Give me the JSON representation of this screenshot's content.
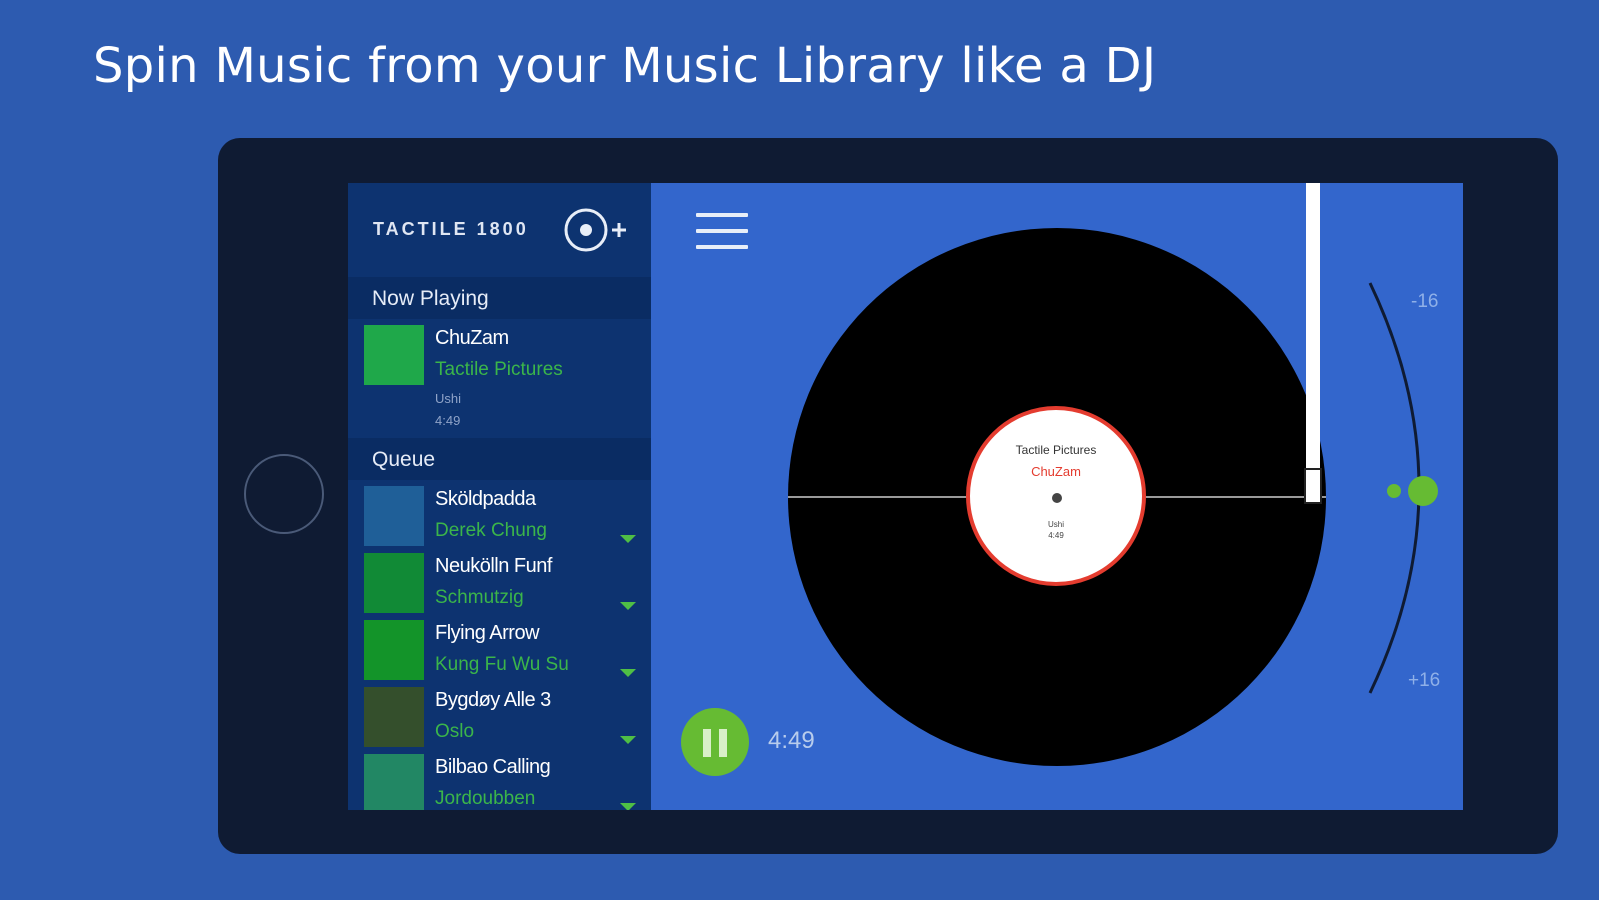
{
  "headline": "Spin Music from your Music Library like a DJ",
  "sidebar": {
    "brand": "TACTILE 1800",
    "now_playing_header": "Now Playing",
    "queue_header": "Queue",
    "now_playing": {
      "title": "ChuZam",
      "artist": "Tactile Pictures",
      "album": "Ushi",
      "duration": "4:49",
      "art_color": "#1fa84a"
    },
    "queue": [
      {
        "title": "Sköldpadda",
        "artist": "Derek Chung",
        "art_color": "#1f5f98"
      },
      {
        "title": "Neukölln Funf",
        "artist": "Schmutzig",
        "art_color": "#118a36"
      },
      {
        "title": "Flying Arrow",
        "artist": "Kung Fu Wu Su",
        "art_color": "#139429"
      },
      {
        "title": "Bygdøy Alle 3",
        "artist": "Oslo",
        "art_color": "#344f2c"
      },
      {
        "title": "Bilbao Calling",
        "artist": "Jordoubben",
        "art_color": "#228764"
      }
    ]
  },
  "player": {
    "record_label": {
      "artist": "Tactile Pictures",
      "title": "ChuZam",
      "meta1": "Ushi",
      "meta2": "4:49"
    },
    "pitch_min_label": "-16",
    "pitch_max_label": "+16",
    "time": "4:49",
    "state": "playing"
  },
  "colors": {
    "background": "#2d5bb0",
    "device": "#0f1b33",
    "main": "#3366cc",
    "sidebar": "#0d3370",
    "accent_green": "#66bb33",
    "label_red": "#e43c2f"
  },
  "icons": [
    "add-record-icon",
    "menu-icon",
    "pause-icon",
    "chevron-down-icon"
  ]
}
